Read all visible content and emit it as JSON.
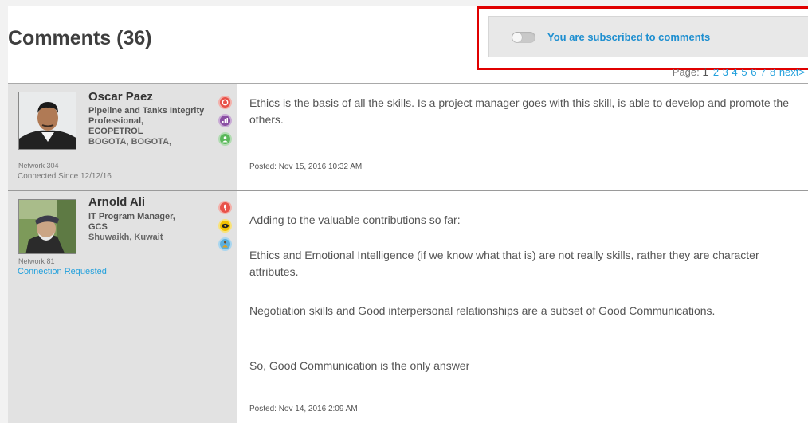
{
  "header": {
    "title": "Comments (36)",
    "subscription_label": "You are subscribed to comments"
  },
  "pager": {
    "label": "Page:",
    "current": "1",
    "pages": [
      "2",
      "3",
      "4",
      "5",
      "6",
      "7",
      "8"
    ],
    "next": "next>"
  },
  "comments": [
    {
      "author": {
        "name": "Oscar Paez",
        "role": "Pipeline and Tanks Integrity Professional,",
        "company": "ECOPETROL",
        "location": "BOGOTA, BOGOTA,",
        "network": "Network 304",
        "connection": "Connected Since 12/12/16"
      },
      "paragraphs": [
        "Ethics is the basis of all the skills. Is a project manager goes with this skill, is able to develop and promote the others."
      ],
      "posted": "Posted: Nov 15, 2016 10:32 AM"
    },
    {
      "author": {
        "name": "Arnold Ali",
        "role": "IT Program Manager,",
        "company": "GCS",
        "location": "Shuwaikh, Kuwait",
        "network": "Network 81",
        "connection": "Connection Requested"
      },
      "paragraphs": [
        "Adding to the valuable contributions so far:",
        "Ethics and Emotional Intelligence (if we know what that is) are not really skills, rather they are character attributes.",
        "Negotiation skills and Good interpersonal relationships are a subset of Good Communications.",
        "So, Good Communication is the only answer"
      ],
      "posted": "Posted: Nov 14, 2016 2:09 AM"
    }
  ],
  "colors": {
    "accent": "#22a0dc",
    "highlight": "#e00000",
    "badge_red": "#e8524a",
    "badge_purple": "#8a4fa3",
    "badge_green": "#5cb85c",
    "badge_yellow": "#f2c200",
    "badge_blue": "#5ab0de"
  }
}
